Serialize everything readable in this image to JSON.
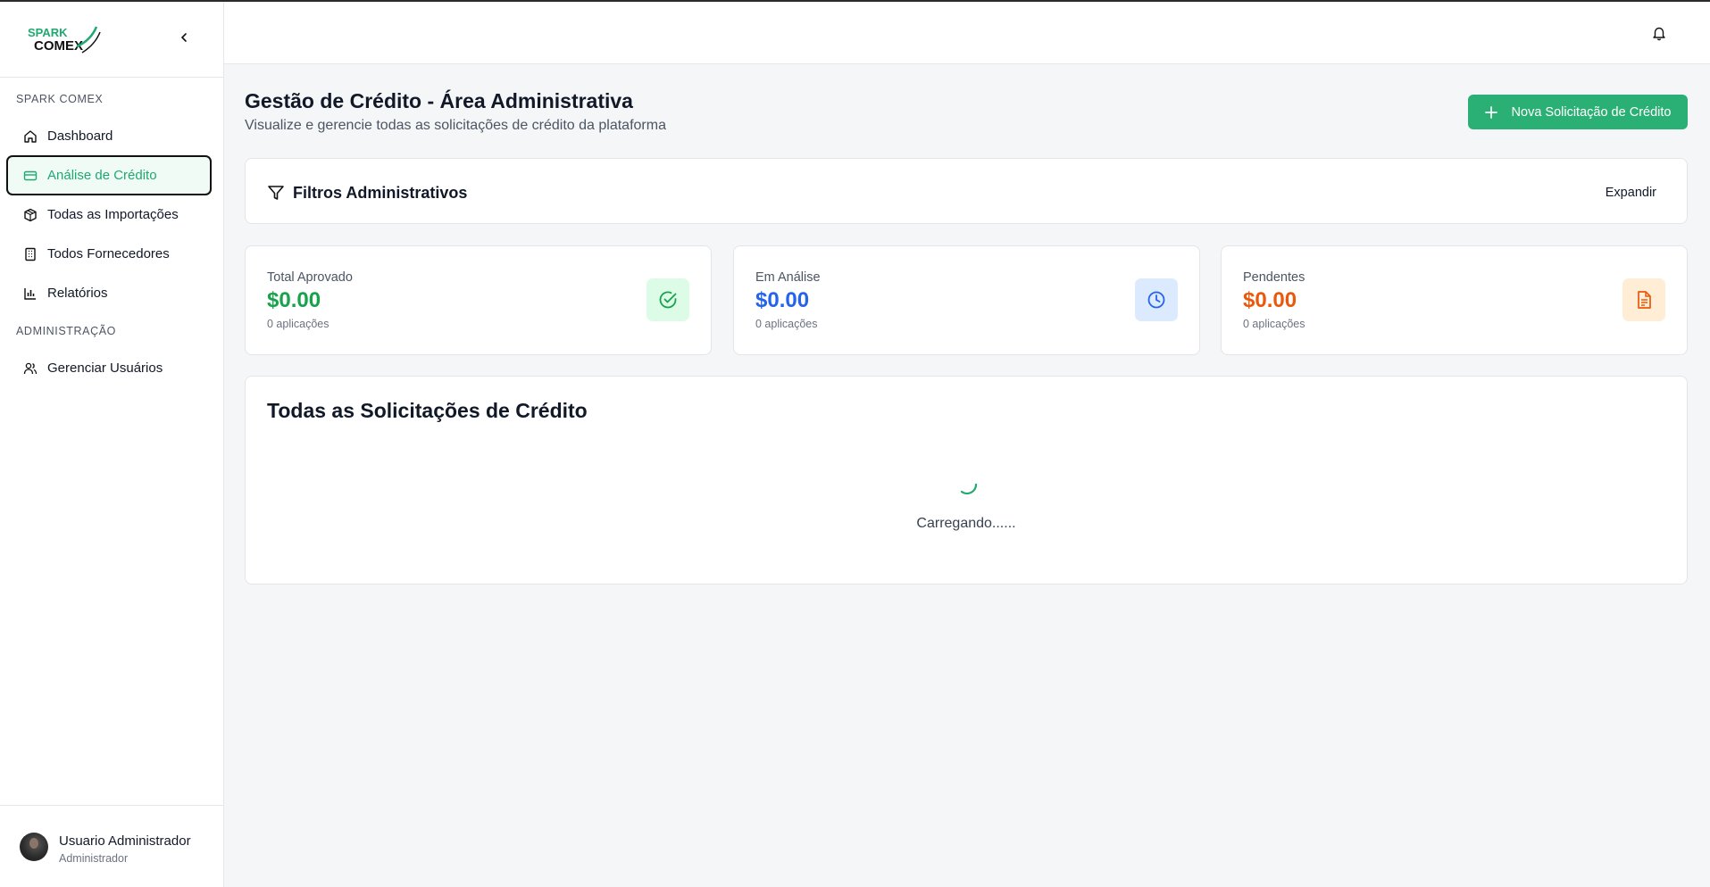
{
  "brand": {
    "logo_line1": "SPARK",
    "logo_line2": "COMEX"
  },
  "sidebar": {
    "section_main": "SPARK COMEX",
    "items": [
      {
        "label": "Dashboard",
        "icon": "home-icon",
        "active": false
      },
      {
        "label": "Análise de Crédito",
        "icon": "credit-card-icon",
        "active": true
      },
      {
        "label": "Todas as Importações",
        "icon": "package-icon",
        "active": false
      },
      {
        "label": "Todos Fornecedores",
        "icon": "building-icon",
        "active": false
      },
      {
        "label": "Relatórios",
        "icon": "bar-chart-icon",
        "active": false
      }
    ],
    "section_admin": "ADMINISTRAÇÃO",
    "admin_items": [
      {
        "label": "Gerenciar Usuários",
        "icon": "users-icon"
      }
    ],
    "user": {
      "name": "Usuario Administrador",
      "role": "Administrador"
    }
  },
  "header": {
    "title": "Gestão de Crédito - Área Administrativa",
    "subtitle": "Visualize e gerencie todas as solicitações de crédito da plataforma",
    "new_button": "Nova Solicitação de Crédito"
  },
  "filters": {
    "title": "Filtros Administrativos",
    "expand_label": "Expandir"
  },
  "stats": [
    {
      "label": "Total Aprovado",
      "value": "$0.00",
      "count": "0 aplicações",
      "color": "#17a34a",
      "icon": "check-circle-icon",
      "icon_bg": "#dcfce7"
    },
    {
      "label": "Em Análise",
      "value": "$0.00",
      "count": "0 aplicações",
      "color": "#2563eb",
      "icon": "clock-icon",
      "icon_bg": "#dbeafe"
    },
    {
      "label": "Pendentes",
      "value": "$0.00",
      "count": "0 aplicações",
      "color": "#ea580c",
      "icon": "file-text-icon",
      "icon_bg": "#ffedd5"
    }
  ],
  "requests": {
    "title": "Todas as Solicitações de Crédito",
    "loading_text": "Carregando......"
  },
  "colors": {
    "accent": "#2aaf74",
    "active_text": "#1fa971"
  }
}
